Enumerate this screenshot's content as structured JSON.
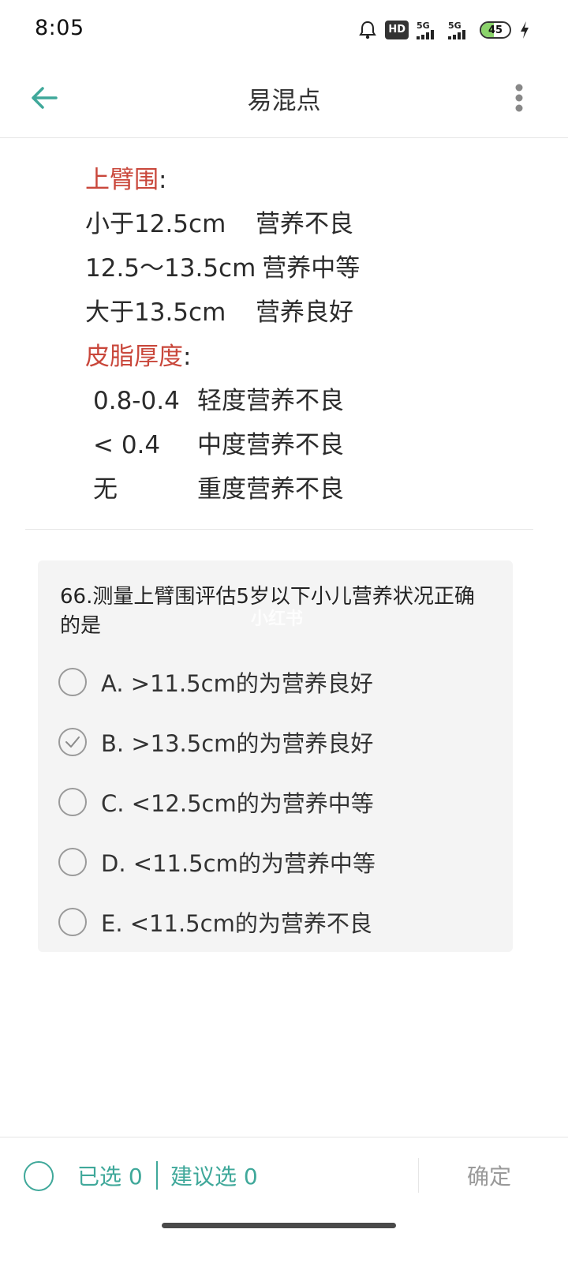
{
  "status_bar": {
    "time": "8:05",
    "hd_label": "HD",
    "network_1": "5G",
    "network_2": "5G",
    "battery_level": "45",
    "battery_fraction": 0.45,
    "icons": [
      "alarm-bell-icon",
      "hd-icon",
      "signal-5g-icon",
      "signal-5g-icon",
      "battery-icon",
      "charging-bolt-icon"
    ]
  },
  "header": {
    "title": "易混点",
    "back_icon": "arrow-left-icon",
    "more_icon": "more-vertical-icon",
    "accent_color": "#3fa89a"
  },
  "notes": {
    "section1": {
      "heading": "上臂围",
      "colon": ":",
      "rows": [
        {
          "range": "小于12.5cm",
          "status": "营养不良"
        },
        {
          "range": "12.5～13.5cm",
          "status": "营养中等"
        },
        {
          "range": "大于13.5cm",
          "status": "营养良好"
        }
      ]
    },
    "section2": {
      "heading": "皮脂厚度",
      "colon": ":",
      "rows": [
        {
          "range": "0.8-0.4",
          "status": "轻度营养不良"
        },
        {
          "range": "< 0.4",
          "status": "中度营养不良"
        },
        {
          "range": "无",
          "status": "重度营养不良"
        }
      ]
    },
    "heading_color": "#c9473b"
  },
  "question": {
    "text": "66.测量上臂围评估5岁以下小儿营养状况正确的是",
    "options": [
      {
        "label": "A. >11.5cm的为营养良好",
        "checked": false
      },
      {
        "label": "B. >13.5cm的为营养良好",
        "checked": true
      },
      {
        "label": "C. <12.5cm的为营养中等",
        "checked": false
      },
      {
        "label": "D. <11.5cm的为营养中等",
        "checked": false
      },
      {
        "label": "E. <11.5cm的为营养不良",
        "checked": false
      }
    ]
  },
  "watermark": "小红书",
  "bottom_bar": {
    "selected_label": "已选 0",
    "suggested_label": "建议选 0",
    "confirm_label": "确定"
  }
}
